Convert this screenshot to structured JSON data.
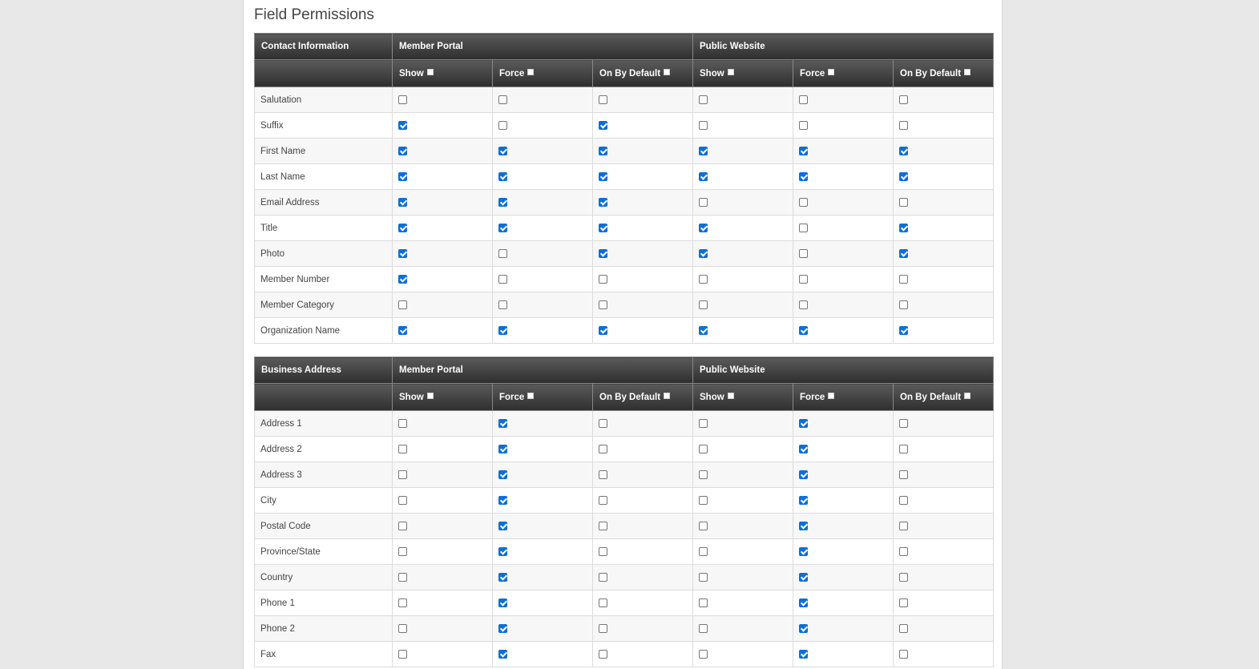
{
  "page_title": "Field Permissions",
  "column_labels": {
    "member_portal": "Member Portal",
    "public_website": "Public Website",
    "show": "Show",
    "force": "Force",
    "on_by_default": "On By Default"
  },
  "sections": [
    {
      "title": "Contact Information",
      "rows": [
        {
          "label": "Salutation",
          "checks": [
            0,
            0,
            0,
            0,
            0,
            0
          ]
        },
        {
          "label": "Suffix",
          "checks": [
            1,
            0,
            1,
            0,
            0,
            0
          ]
        },
        {
          "label": "First Name",
          "checks": [
            1,
            1,
            1,
            1,
            1,
            1
          ]
        },
        {
          "label": "Last Name",
          "checks": [
            1,
            1,
            1,
            1,
            1,
            1
          ]
        },
        {
          "label": "Email Address",
          "checks": [
            1,
            1,
            1,
            0,
            0,
            0
          ]
        },
        {
          "label": "Title",
          "checks": [
            1,
            1,
            1,
            1,
            0,
            1
          ]
        },
        {
          "label": "Photo",
          "checks": [
            1,
            0,
            1,
            1,
            0,
            1
          ]
        },
        {
          "label": "Member Number",
          "checks": [
            1,
            0,
            0,
            0,
            0,
            0
          ]
        },
        {
          "label": "Member Category",
          "checks": [
            0,
            0,
            0,
            0,
            0,
            0
          ]
        },
        {
          "label": "Organization Name",
          "checks": [
            1,
            1,
            1,
            1,
            1,
            1
          ]
        }
      ]
    },
    {
      "title": "Business Address",
      "rows": [
        {
          "label": "Address 1",
          "checks": [
            0,
            1,
            0,
            0,
            1,
            0
          ]
        },
        {
          "label": "Address 2",
          "checks": [
            0,
            1,
            0,
            0,
            1,
            0
          ]
        },
        {
          "label": "Address 3",
          "checks": [
            0,
            1,
            0,
            0,
            1,
            0
          ]
        },
        {
          "label": "City",
          "checks": [
            0,
            1,
            0,
            0,
            1,
            0
          ]
        },
        {
          "label": "Postal Code",
          "checks": [
            0,
            1,
            0,
            0,
            1,
            0
          ]
        },
        {
          "label": "Province/State",
          "checks": [
            0,
            1,
            0,
            0,
            1,
            0
          ]
        },
        {
          "label": "Country",
          "checks": [
            0,
            1,
            0,
            0,
            1,
            0
          ]
        },
        {
          "label": "Phone 1",
          "checks": [
            0,
            1,
            0,
            0,
            1,
            0
          ]
        },
        {
          "label": "Phone 2",
          "checks": [
            0,
            1,
            0,
            0,
            1,
            0
          ]
        },
        {
          "label": "Fax",
          "checks": [
            0,
            1,
            0,
            0,
            1,
            0
          ]
        }
      ]
    }
  ],
  "colors": {
    "checked": "#0b6fd8",
    "header_dark": "#2e2e2e"
  }
}
